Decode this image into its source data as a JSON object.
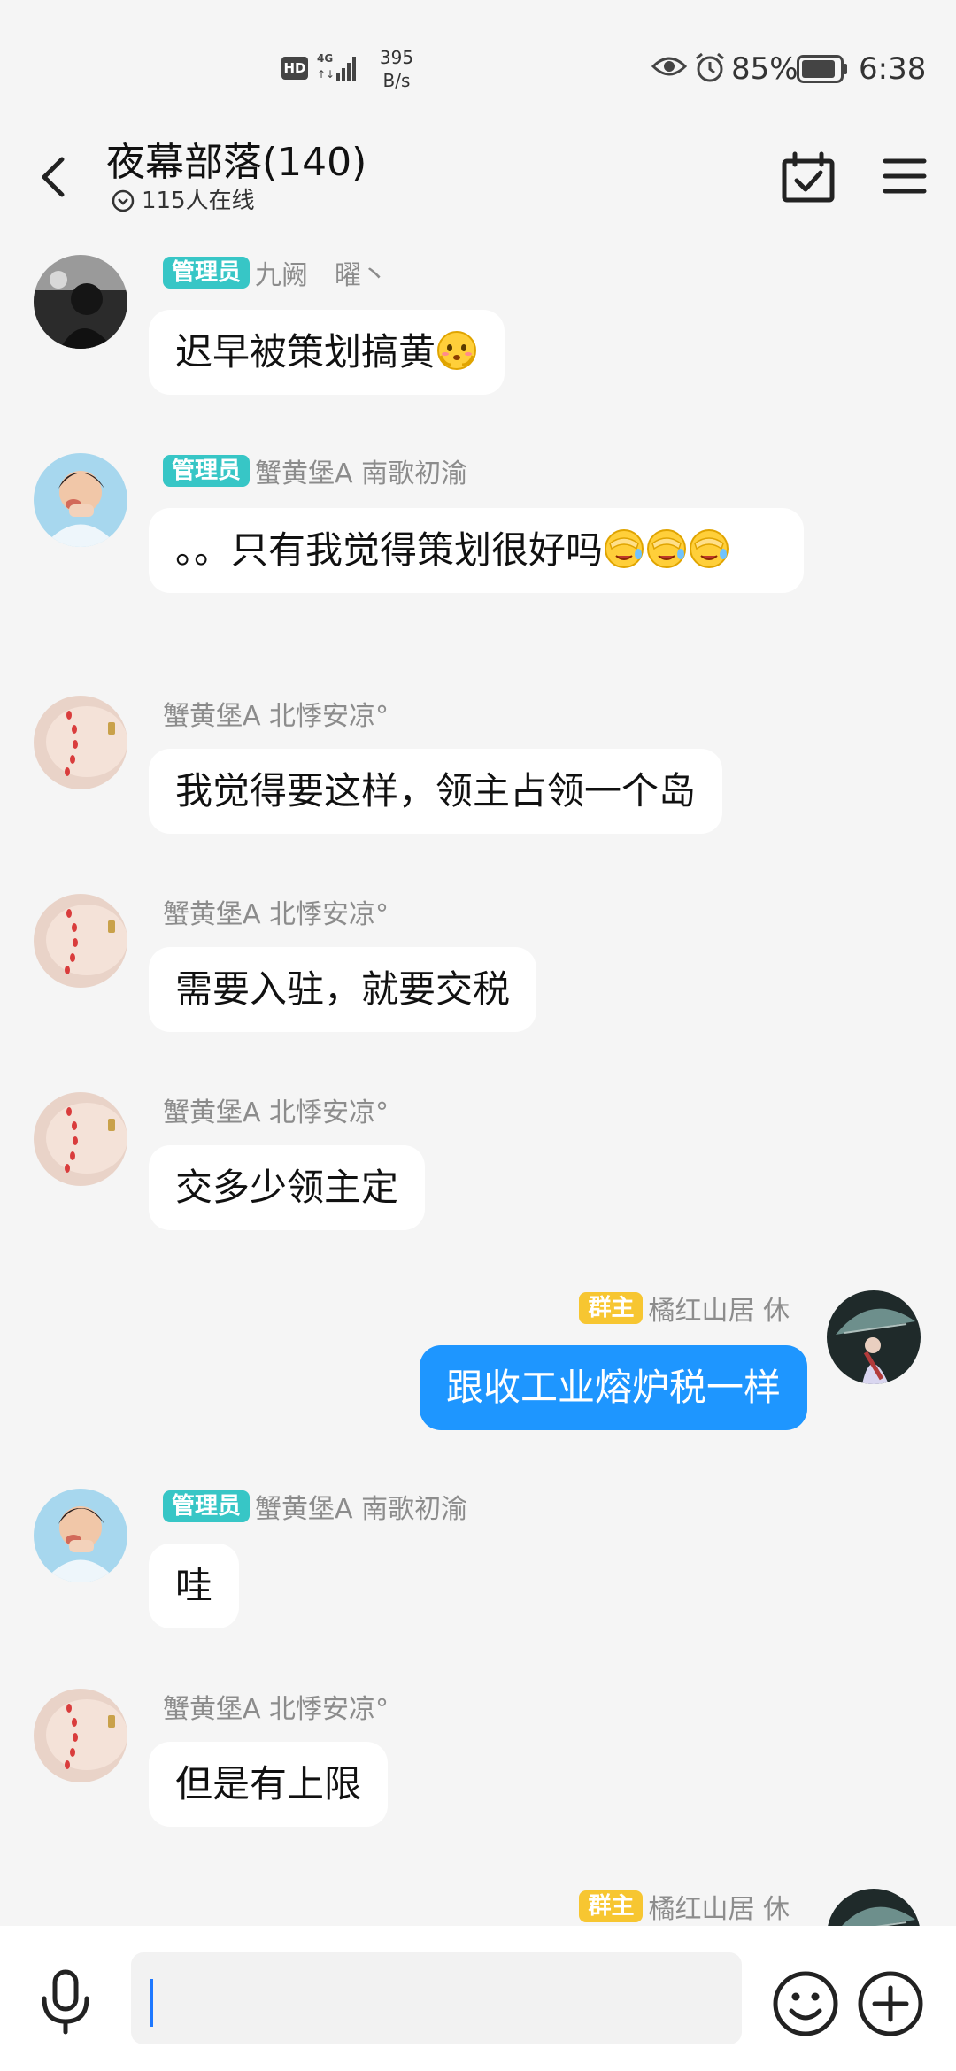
{
  "status_bar": {
    "hd": "HD",
    "network": "4G",
    "speed_value": "395",
    "speed_unit": "B/s",
    "battery": "85%",
    "time": "6:38"
  },
  "header": {
    "title": "夜幕部落(140)",
    "online": "115人在线"
  },
  "colors": {
    "accent_blue": "#1e96ff",
    "admin_badge": "#37c6c6",
    "owner_badge": "#f7c631",
    "bubble_white": "#ffffff",
    "background": "#f5f5f5"
  },
  "messages": [
    {
      "side": "left",
      "avatar": "dark-photo-avatar",
      "badge": "管理员",
      "sender": "九阙　曜丶",
      "text": "迟早被策划搞黄",
      "emojis": [
        "blush-emoji"
      ]
    },
    {
      "side": "left",
      "avatar": "boy-photo-avatar",
      "badge": "管理员",
      "sender": "蟹黄堡A 南歌初渝",
      "text": "。。只有我觉得策划很好吗",
      "emojis": [
        "facepalm-emoji",
        "facepalm-emoji",
        "facepalm-emoji"
      ]
    },
    {
      "side": "left",
      "avatar": "hand-photo-avatar",
      "badge": "",
      "sender": "蟹黄堡A 北悸安凉°",
      "text": "我觉得要这样，领主占领一个岛",
      "emojis": []
    },
    {
      "side": "left",
      "avatar": "hand-photo-avatar",
      "badge": "",
      "sender": "蟹黄堡A 北悸安凉°",
      "text": "需要入驻，就要交税",
      "emojis": []
    },
    {
      "side": "left",
      "avatar": "hand-photo-avatar",
      "badge": "",
      "sender": "蟹黄堡A 北悸安凉°",
      "text": "交多少领主定",
      "emojis": []
    },
    {
      "side": "right",
      "avatar": "umbrella-photo-avatar",
      "badge": "群主",
      "sender": "橘红山居 休",
      "text": "跟收工业熔炉税一样",
      "emojis": []
    },
    {
      "side": "left",
      "avatar": "boy-photo-avatar",
      "badge": "管理员",
      "sender": "蟹黄堡A 南歌初渝",
      "text": "哇",
      "emojis": []
    },
    {
      "side": "left",
      "avatar": "hand-photo-avatar",
      "badge": "",
      "sender": "蟹黄堡A 北悸安凉°",
      "text": "但是有上限",
      "emojis": []
    },
    {
      "side": "right",
      "avatar": "umbrella-photo-avatar",
      "badge": "群主",
      "sender": "橘红山居 休",
      "text": "",
      "emojis": []
    }
  ],
  "input": {
    "placeholder": ""
  }
}
